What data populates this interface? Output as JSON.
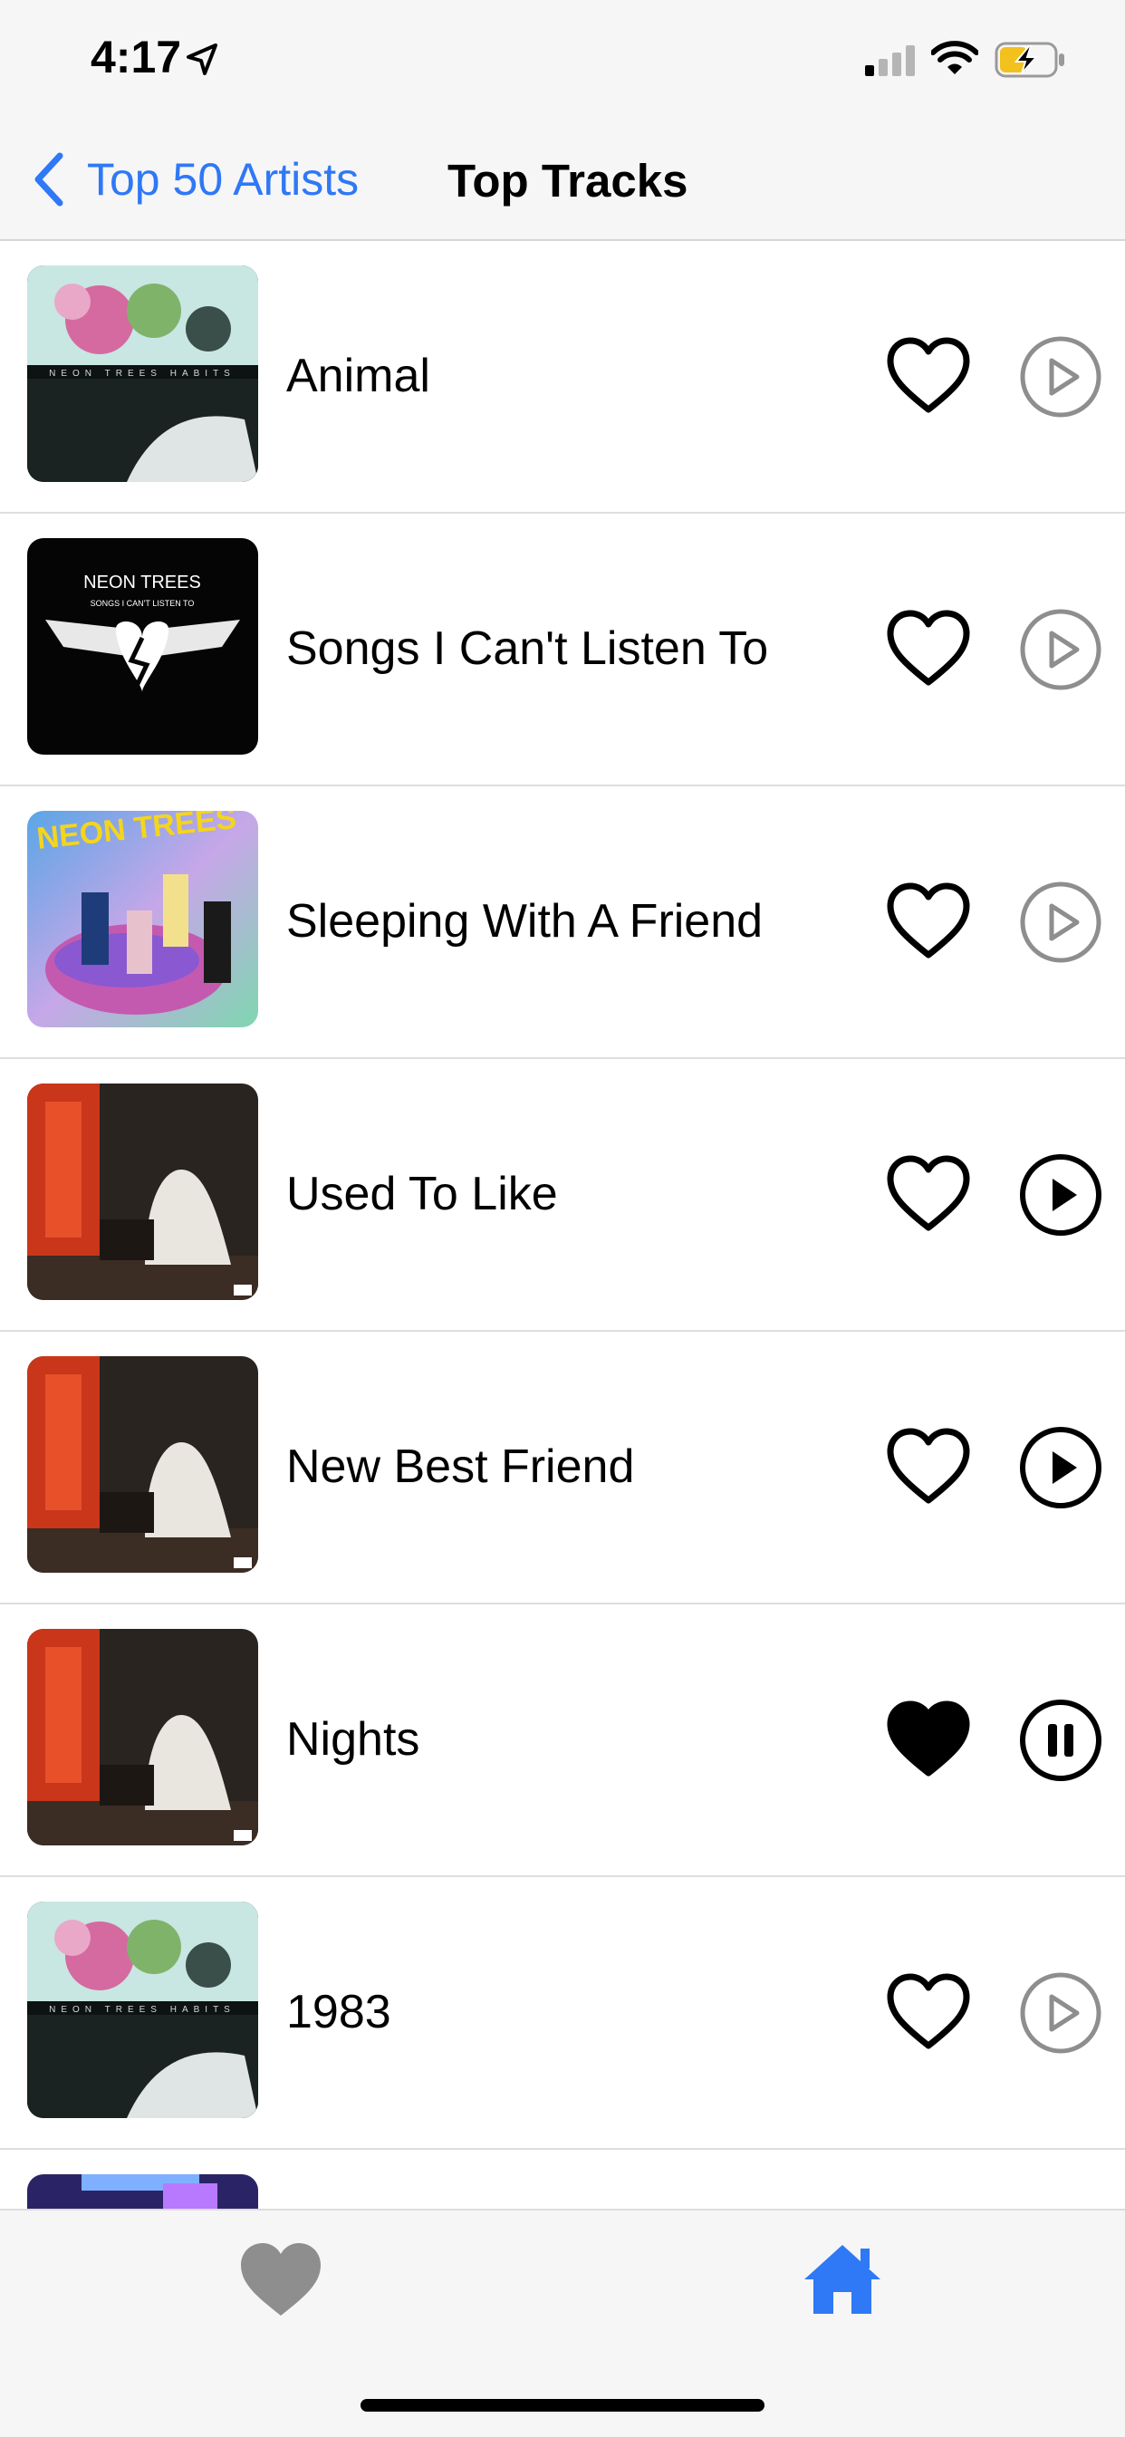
{
  "status_bar": {
    "time": "4:17"
  },
  "nav": {
    "back_label": "Top 50 Artists",
    "title": "Top Tracks"
  },
  "tracks": [
    {
      "title": "Animal",
      "favorited": false,
      "state": "play-inactive",
      "artwork": "habits-album-art"
    },
    {
      "title": "Songs I Can't Listen To",
      "favorited": false,
      "state": "play-inactive",
      "artwork": "songs-i-cant-listen-to-art",
      "art_text": {
        "band": "NEON TREES",
        "sub": "SONGS I CAN'T LISTEN TO"
      }
    },
    {
      "title": "Sleeping With A Friend",
      "favorited": false,
      "state": "play-inactive",
      "artwork": "pop-psychology-art",
      "art_text": {
        "band": "NEON TREES"
      }
    },
    {
      "title": "Used To Like",
      "favorited": false,
      "state": "play",
      "artwork": "ghost-room-art"
    },
    {
      "title": "New Best Friend",
      "favorited": false,
      "state": "play",
      "artwork": "ghost-room-art"
    },
    {
      "title": "Nights",
      "favorited": true,
      "state": "pause",
      "artwork": "ghost-room-art"
    },
    {
      "title": "1983",
      "favorited": false,
      "state": "play-inactive",
      "artwork": "habits-album-art"
    },
    {
      "title": "",
      "favorited": false,
      "state": "",
      "artwork": "purple-partial-art"
    }
  ],
  "album_art_text": {
    "habits": "NEON TREES HABITS"
  },
  "tabbar": {
    "items": [
      "favorites-tab",
      "home-tab"
    ],
    "active": "home-tab"
  },
  "colors": {
    "accent": "#2f78f6",
    "inactive_tab": "#8e8e8e",
    "bar_bg": "#f6f6f6"
  }
}
